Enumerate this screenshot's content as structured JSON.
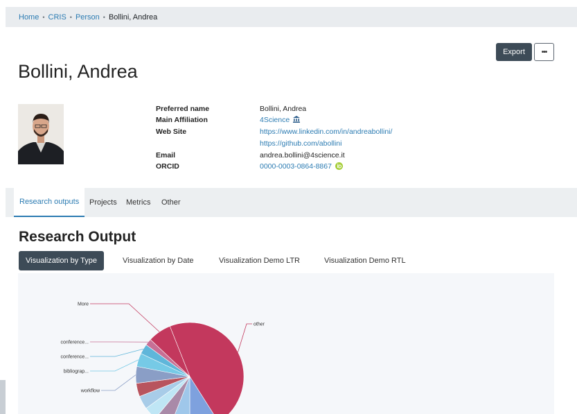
{
  "breadcrumb": {
    "items": [
      "Home",
      "CRIS",
      "Person"
    ],
    "current": "Bollini, Andrea"
  },
  "actions": {
    "export_label": "Export",
    "more_label": "•••"
  },
  "person": {
    "name": "Bollini, Andrea",
    "fields": {
      "preferred_name_label": "Preferred name",
      "preferred_name": "Bollini, Andrea",
      "main_affiliation_label": "Main Affiliation",
      "main_affiliation": "4Science",
      "web_site_label": "Web Site",
      "web_site_1": "https://www.linkedin.com/in/andreabollini/",
      "web_site_2": "https://github.com/abollini",
      "email_label": "Email",
      "email": "andrea.bollini@4science.it",
      "orcid_label": "ORCID",
      "orcid": "0000-0003-0864-8867"
    }
  },
  "tabs": [
    "Research outputs",
    "Projects",
    "Metrics",
    "Other"
  ],
  "research_output": {
    "title": "Research Output",
    "viz_tabs": [
      "Visualization by Type",
      "Visualization by Date",
      "Visualization Demo LTR",
      "Visualization Demo RTL"
    ]
  },
  "chart_data": {
    "type": "pie",
    "slices": [
      {
        "label": "other",
        "value": 47,
        "color": "#c3385d"
      },
      {
        "label": "",
        "value": 9,
        "color": "#7ea1de"
      },
      {
        "label": "",
        "value": 6,
        "color": "#9fc7ea"
      },
      {
        "label": "",
        "value": 5,
        "color": "#a98aa8"
      },
      {
        "label": "",
        "value": 4,
        "color": "#bfe6f5"
      },
      {
        "label": "",
        "value": 4,
        "color": "#a8cce8"
      },
      {
        "label": "",
        "value": 4,
        "color": "#b8545e"
      },
      {
        "label": "workflow",
        "value": 5,
        "color": "#8a9ec6"
      },
      {
        "label": "bibliograp...",
        "value": 4,
        "color": "#76cae6"
      },
      {
        "label": "conference...",
        "value": 3,
        "color": "#5fb6da"
      },
      {
        "label": "conference...",
        "value": 2,
        "color": "#c76f95"
      },
      {
        "label": "More",
        "value": 7,
        "color": "#c3385d"
      }
    ]
  },
  "colors": {
    "accent": "#2b7bb2",
    "button_dark": "#3d4b57",
    "orcid_green": "#a6ce39"
  }
}
